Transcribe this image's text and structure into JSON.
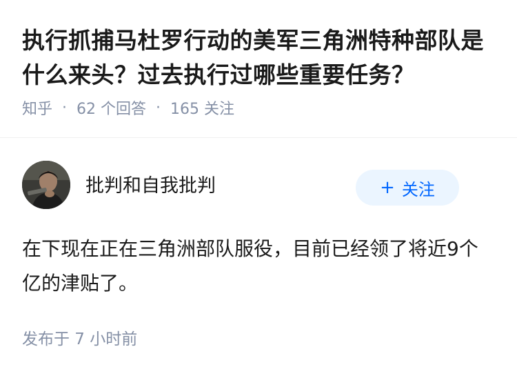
{
  "question": {
    "title": "执行抓捕马杜罗行动的美军三角洲特种部队是什么来头？过去执行过哪些重要任务？",
    "source": "知乎",
    "answers_count": "62 个回答",
    "followers_count": "165 关注",
    "separator": "·"
  },
  "answer": {
    "author_name": "批判和自我批判",
    "avatar_icon": "avatar-photo",
    "follow_button": {
      "icon": "+",
      "label": "关注"
    },
    "content": "在下现在正在三角洲部队服役，目前已经领了将近9个亿的津贴了。",
    "published": "发布于  7 小时前"
  },
  "colors": {
    "text_primary": "#1a1a1a",
    "text_secondary": "#8590a6",
    "accent": "#0066ff",
    "follow_bg": "#ebf5ff"
  }
}
